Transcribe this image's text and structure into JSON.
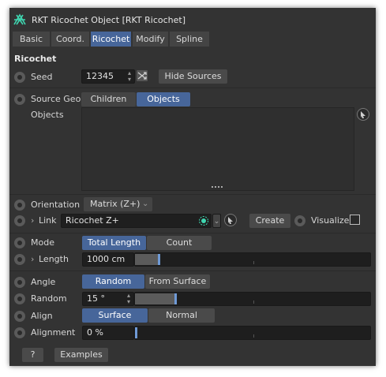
{
  "window": {
    "title": "RKT Ricochet Object [RKT Ricochet]"
  },
  "tabs": [
    {
      "label": "Basic"
    },
    {
      "label": "Coord."
    },
    {
      "label": "Ricochet"
    },
    {
      "label": "Modify"
    },
    {
      "label": "Spline"
    }
  ],
  "section": {
    "title": "Ricochet"
  },
  "seed": {
    "label": "Seed",
    "value": "12345",
    "hide_sources_label": "Hide Sources"
  },
  "source_geo": {
    "label": "Source Geo",
    "options": [
      "Children",
      "Objects"
    ],
    "selected": "Objects",
    "objects_label": "Objects"
  },
  "orientation": {
    "label": "Orientation",
    "value": "Matrix (Z+)"
  },
  "link": {
    "label": "Link",
    "value": "Ricochet Z+",
    "create_label": "Create",
    "visualize_label": "Visualize"
  },
  "mode": {
    "label": "Mode",
    "options": [
      "Total Length",
      "Count"
    ],
    "selected": "Total Length"
  },
  "length": {
    "label": "Length",
    "value": "1000 cm",
    "slider_fraction": 0.1
  },
  "angle": {
    "label": "Angle",
    "options": [
      "Random",
      "From Surface"
    ],
    "selected": "Random"
  },
  "random": {
    "label": "Random",
    "value": "15 °",
    "slider_fraction": 0.17
  },
  "align": {
    "label": "Align",
    "options": [
      "Surface",
      "Normal"
    ],
    "selected": "Surface"
  },
  "alignment": {
    "label": "Alignment",
    "value": "0 %",
    "slider_fraction": 0.0
  },
  "footer": {
    "help_label": "?",
    "examples_label": "Examples"
  },
  "colors": {
    "panel": "#333333",
    "accent": "#47669a",
    "field": "#1f1f1f",
    "logo": "#3fd6b0"
  }
}
